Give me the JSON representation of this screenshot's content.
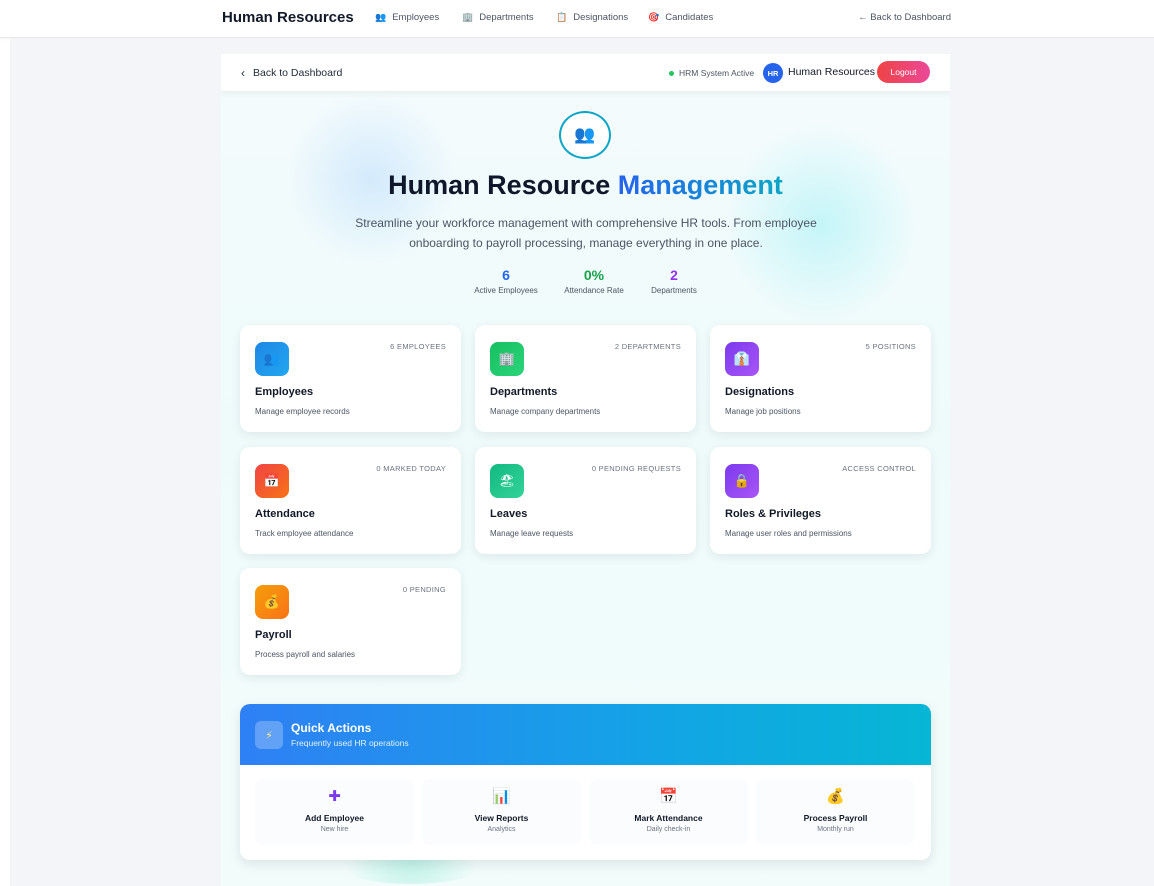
{
  "topnav": {
    "brand": "Human Resources",
    "links": [
      {
        "label": "Employees",
        "icon": "👥"
      },
      {
        "label": "Departments",
        "icon": "🏢"
      },
      {
        "label": "Designations",
        "icon": "📋"
      },
      {
        "label": "Candidates",
        "icon": "🎯"
      }
    ],
    "back": "← Back to Dashboard"
  },
  "header": {
    "back": "Back to Dashboard",
    "status": "HRM System Active",
    "avatar": "HR",
    "user": "Human Resources",
    "logout": "Logout"
  },
  "hero": {
    "icon": "👥",
    "title_main": "Human Resource",
    "title_accent": "Management",
    "subtitle": "Streamline your workforce management with comprehensive HR tools. From employee onboarding to payroll processing, manage everything in one place."
  },
  "stats": [
    {
      "value": "6",
      "label": "Active Employees",
      "color": "#2563eb"
    },
    {
      "value": "0%",
      "label": "Attendance Rate",
      "color": "#16a34a"
    },
    {
      "value": "2",
      "label": "Departments",
      "color": "#9333ea"
    }
  ],
  "cards": [
    {
      "title": "Employees",
      "desc": "Manage employee records",
      "badge": "6 EMPLOYEES",
      "icon": "👥",
      "color": "#1e88e5"
    },
    {
      "title": "Departments",
      "desc": "Manage company departments",
      "badge": "2 DEPARTMENTS",
      "icon": "🏢",
      "color": "#22c55e"
    },
    {
      "title": "Designations",
      "desc": "Manage job positions",
      "badge": "5 POSITIONS",
      "icon": "👔",
      "color": "#8b5cf6"
    },
    {
      "title": "Attendance",
      "desc": "Track employee attendance",
      "badge": "0 MARKED TODAY",
      "icon": "📅",
      "color": "#f97316"
    },
    {
      "title": "Leaves",
      "desc": "Manage leave requests",
      "badge": "0 PENDING REQUESTS",
      "icon": "🏖",
      "color": "#10b981"
    },
    {
      "title": "Roles & Privileges",
      "desc": "Manage user roles and permissions",
      "badge": "ACCESS CONTROL",
      "icon": "🔒",
      "color": "#8b5cf6"
    },
    {
      "title": "Payroll",
      "desc": "Process payroll and salaries",
      "badge": "0 PENDING",
      "icon": "💰",
      "color": "#f59e0b"
    }
  ],
  "quick_actions": {
    "icon": "⚡",
    "title": "Quick Actions",
    "subtitle": "Frequently used HR operations",
    "items": [
      {
        "title": "Add Employee",
        "sub": "New hire",
        "icon": "✚",
        "color": "#7c3aed"
      },
      {
        "title": "View Reports",
        "sub": "Analytics",
        "icon": "📊",
        "color": "#2563eb"
      },
      {
        "title": "Mark Attendance",
        "sub": "Daily check-in",
        "icon": "📅",
        "color": "#2563eb"
      },
      {
        "title": "Process Payroll",
        "sub": "Monthly run",
        "icon": "💰",
        "color": "#f59e0b"
      }
    ]
  }
}
